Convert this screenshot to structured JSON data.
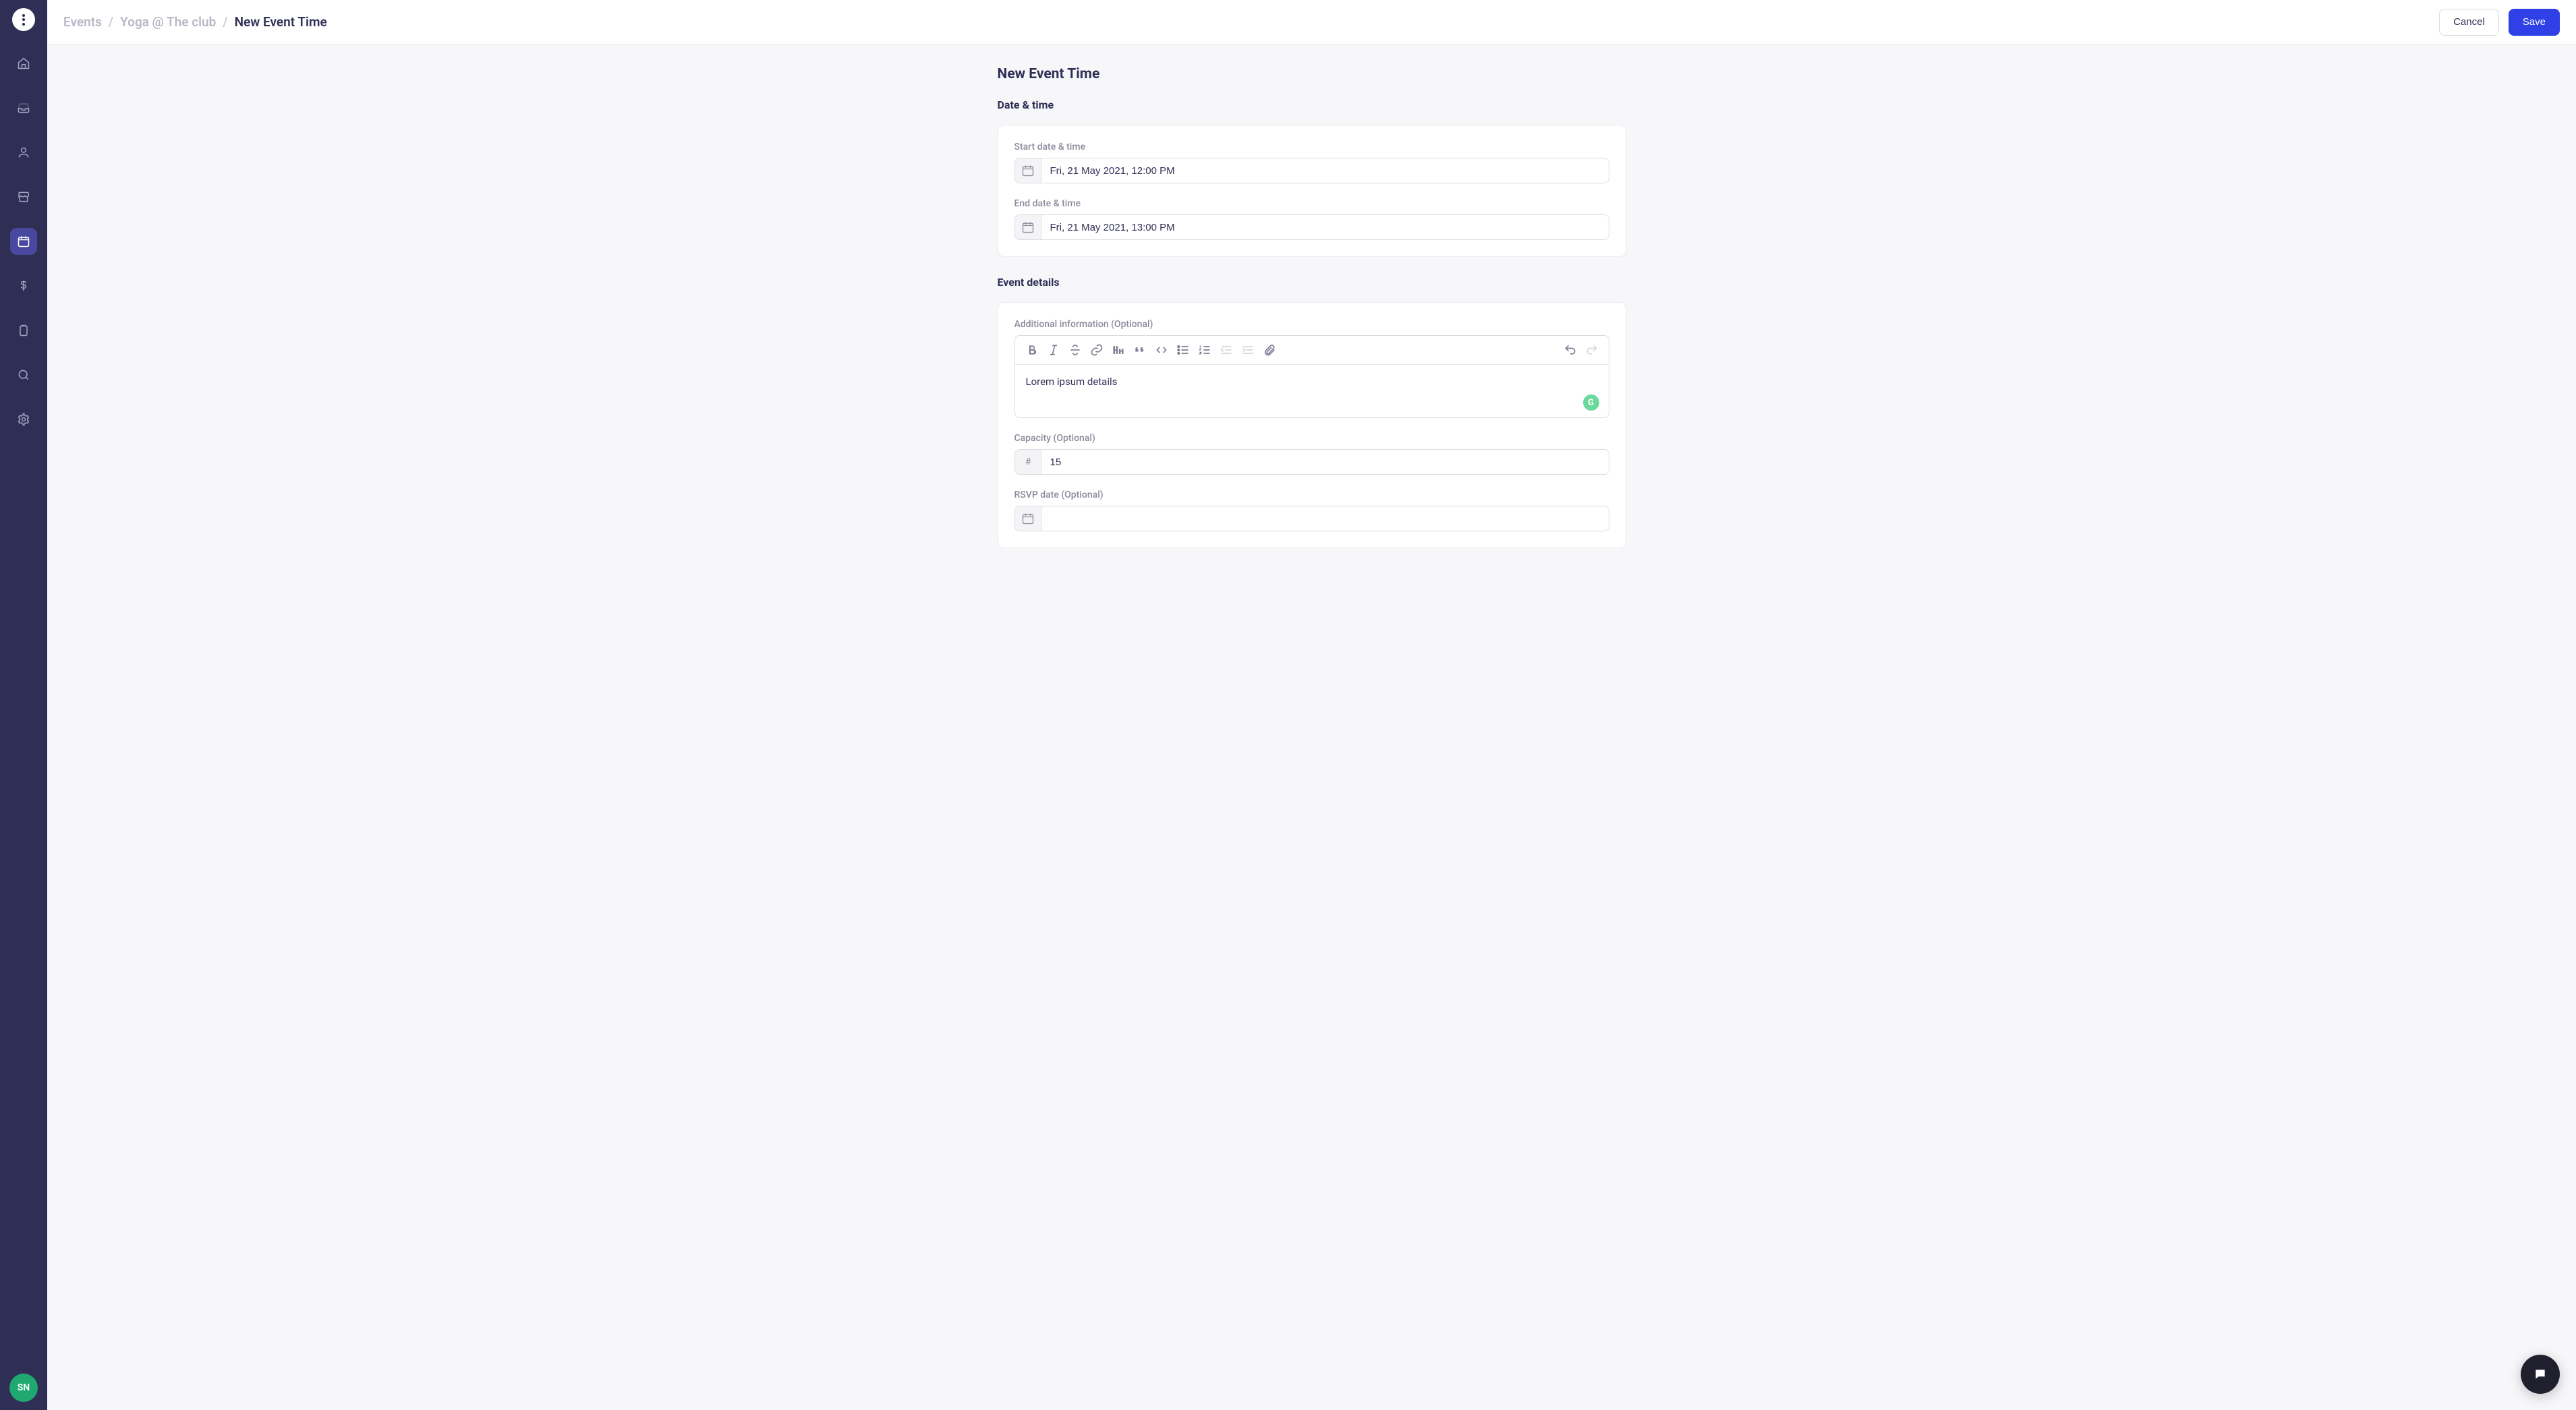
{
  "user": {
    "initials": "SN"
  },
  "breadcrumb": {
    "events": "Events",
    "parent": "Yoga @ The club",
    "current": "New Event Time"
  },
  "actions": {
    "cancel": "Cancel",
    "save": "Save"
  },
  "form": {
    "page_title": "New Event Time",
    "section_date": "Date & time",
    "section_details": "Event details",
    "start": {
      "label": "Start date & time",
      "value": "Fri, 21 May 2021, 12:00 PM"
    },
    "end": {
      "label": "End date & time",
      "value": "Fri, 21 May 2021, 13:00 PM"
    },
    "additional": {
      "label": "Additional information (Optional)",
      "content": "Lorem ipsum details"
    },
    "capacity": {
      "label": "Capacity (Optional)",
      "prefix": "#",
      "value": "15"
    },
    "rsvp": {
      "label": "RSVP date (Optional)",
      "value": ""
    }
  },
  "nav_items": [
    {
      "name": "home-icon",
      "active": false
    },
    {
      "name": "inbox-icon",
      "active": false
    },
    {
      "name": "people-icon",
      "active": false
    },
    {
      "name": "store-icon",
      "active": false
    },
    {
      "name": "calendar-icon",
      "active": true
    },
    {
      "name": "dollar-icon",
      "active": false
    },
    {
      "name": "clipboard-icon",
      "active": false
    },
    {
      "name": "search-icon",
      "active": false
    },
    {
      "name": "settings-icon",
      "active": false
    }
  ],
  "editor_tools": [
    "bold",
    "italic",
    "strikethrough",
    "link",
    "heading",
    "quote",
    "code",
    "bullet-list",
    "ordered-list",
    "indent-decrease",
    "indent-increase",
    "attachment"
  ]
}
